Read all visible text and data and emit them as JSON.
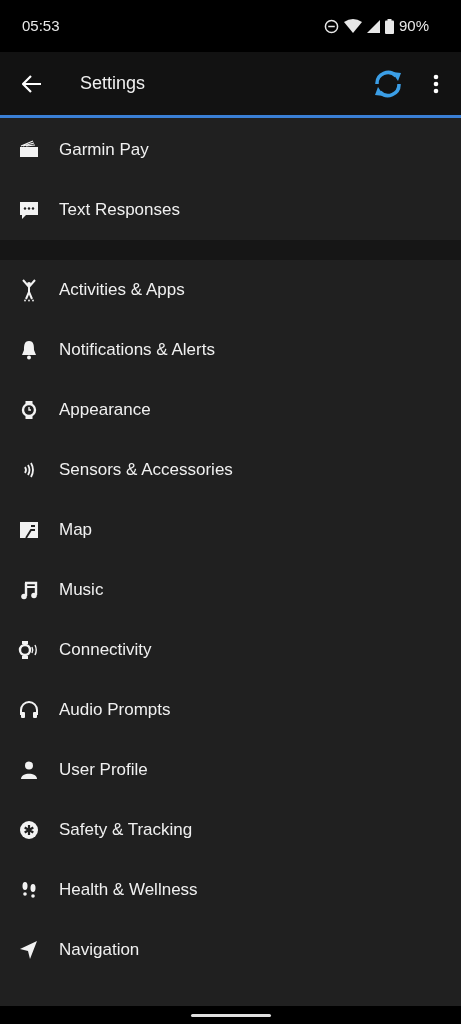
{
  "status_bar": {
    "time": "05:53",
    "battery": "90%"
  },
  "toolbar": {
    "title": "Settings"
  },
  "sections": [
    {
      "items": [
        {
          "label": "Garmin Pay"
        },
        {
          "label": "Text Responses"
        }
      ]
    },
    {
      "items": [
        {
          "label": "Activities & Apps"
        },
        {
          "label": "Notifications & Alerts"
        },
        {
          "label": "Appearance"
        },
        {
          "label": "Sensors & Accessories"
        },
        {
          "label": "Map"
        },
        {
          "label": "Music"
        },
        {
          "label": "Connectivity"
        },
        {
          "label": "Audio Prompts"
        },
        {
          "label": "User Profile"
        },
        {
          "label": "Safety & Tracking"
        },
        {
          "label": "Health & Wellness"
        },
        {
          "label": "Navigation"
        }
      ]
    }
  ]
}
